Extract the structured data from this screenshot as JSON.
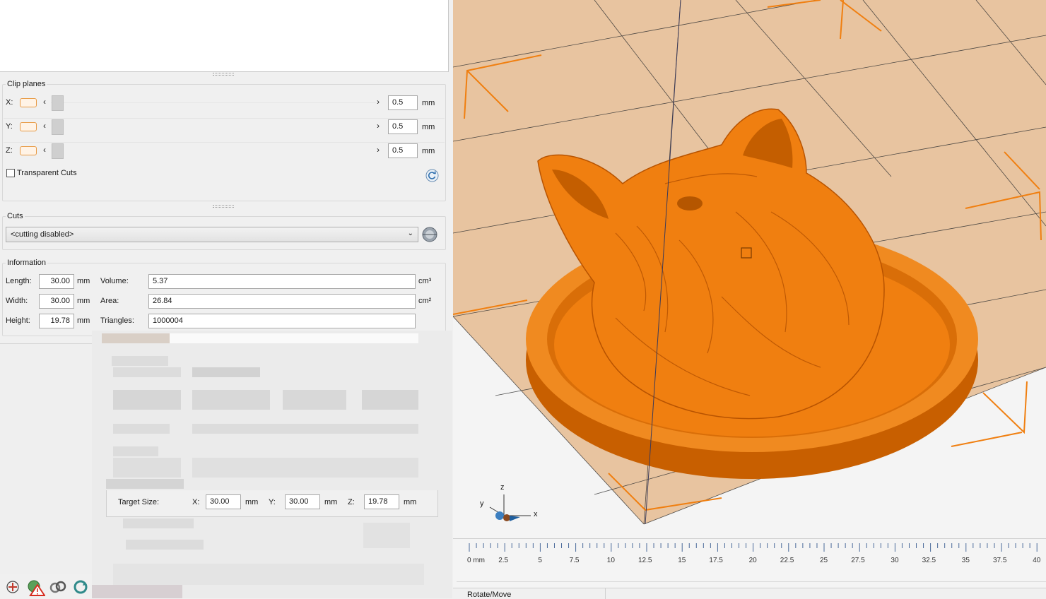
{
  "clip_planes": {
    "title": "Clip planes",
    "rows": [
      {
        "axis": "X:",
        "value": "0.5",
        "unit": "mm"
      },
      {
        "axis": "Y:",
        "value": "0.5",
        "unit": "mm"
      },
      {
        "axis": "Z:",
        "value": "0.5",
        "unit": "mm"
      }
    ],
    "transparent_cuts": "Transparent Cuts"
  },
  "cuts": {
    "title": "Cuts",
    "selected": "<cutting disabled>"
  },
  "information": {
    "title": "Information",
    "length_label": "Length:",
    "length": "30.00",
    "length_unit": "mm",
    "width_label": "Width:",
    "width": "30.00",
    "width_unit": "mm",
    "height_label": "Height:",
    "height": "19.78",
    "height_unit": "mm",
    "volume_label": "Volume:",
    "volume": "5.37",
    "volume_unit": "cm³",
    "area_label": "Area:",
    "area": "26.84",
    "area_unit": "cm²",
    "triangles_label": "Triangles:",
    "triangles": "1000004"
  },
  "target_size": {
    "label": "Target Size:",
    "x_label": "X:",
    "x": "30.00",
    "x_unit": "mm",
    "y_label": "Y:",
    "y": "30.00",
    "y_unit": "mm",
    "z_label": "Z:",
    "z": "19.78",
    "z_unit": "mm"
  },
  "viewport": {
    "axis_x": "x",
    "axis_y": "y",
    "axis_z": "z",
    "model_color": "#f07f10",
    "bed_color": "#e8c4a0"
  },
  "ruler": {
    "labels": [
      "0 mm",
      "2.5",
      "5",
      "7.5",
      "10",
      "12.5",
      "15",
      "17.5",
      "20",
      "22.5",
      "25",
      "27.5",
      "30",
      "32.5",
      "35",
      "37.5",
      "40"
    ]
  },
  "status": {
    "mode": "Rotate/Move"
  },
  "toolbar_icons": [
    "add-icon",
    "warning-icon",
    "link-icon",
    "refresh-icon"
  ]
}
